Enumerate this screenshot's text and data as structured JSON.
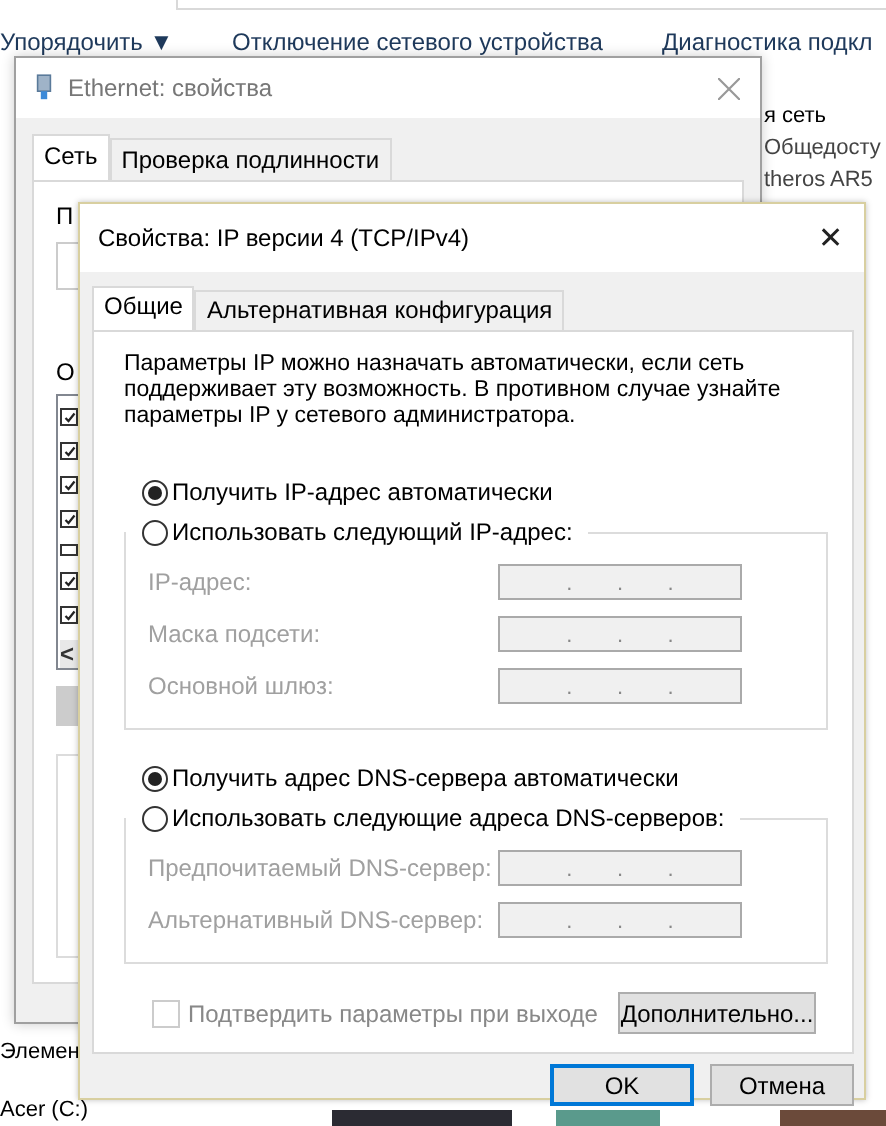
{
  "explorer": {
    "toolbar": [
      "Упорядочить ▼",
      "Отключение сетевого устройства",
      "Диагностика подкл"
    ],
    "details": [
      {
        "text": "я сеть",
        "bold": true
      },
      {
        "text": "Общедосту",
        "bold": false
      },
      {
        "text": "theros AR5",
        "bold": false
      }
    ],
    "labels": [
      "Элемен",
      "Acer (C:)"
    ]
  },
  "ethernet_window": {
    "title": "Ethernet: свойства",
    "tabs": [
      {
        "label": "Сеть",
        "selected": true
      },
      {
        "label": "Проверка подлинности",
        "selected": false
      }
    ],
    "section_labels": [
      "П",
      "О"
    ],
    "components": [
      {
        "checked": true
      },
      {
        "checked": true
      },
      {
        "checked": true
      },
      {
        "checked": true
      },
      {
        "checked": false
      },
      {
        "checked": true
      },
      {
        "checked": true
      }
    ],
    "scroll_arrow": "<"
  },
  "ipv4_dialog": {
    "title": "Свойства: IP версии 4 (TCP/IPv4)",
    "close": "✕",
    "tabs": [
      {
        "label": "Общие",
        "selected": true
      },
      {
        "label": "Альтернативная конфигурация",
        "selected": false
      }
    ],
    "description": "Параметры IP можно назначать автоматически, если сеть поддерживает эту возможность. В противном случае узнайте параметры IP у сетевого администратора.",
    "separator": ".",
    "sections": [
      {
        "auto_option": {
          "label": "Получить IP-адрес автоматически",
          "selected": true
        },
        "manual_option": {
          "label": "Использовать следующий IP-адрес:",
          "selected": false
        },
        "fields": [
          {
            "label": "IP-адрес:",
            "disabled": true
          },
          {
            "label": "Маска подсети:",
            "disabled": true
          },
          {
            "label": "Основной шлюз:",
            "disabled": true
          }
        ]
      },
      {
        "auto_option": {
          "label": "Получить адрес DNS-сервера автоматически",
          "selected": true
        },
        "manual_option": {
          "label": "Использовать следующие адреса DNS-серверов:",
          "selected": false
        },
        "fields": [
          {
            "label": "Предпочитаемый DNS-сервер:",
            "disabled": true
          },
          {
            "label": "Альтернативный DNS-сервер:",
            "disabled": true
          }
        ]
      }
    ],
    "validate": {
      "label": "Подтвердить параметры при выходе",
      "checked": false,
      "disabled": true
    },
    "advanced_button": "Дополнительно...",
    "buttons": [
      {
        "label": "OK",
        "default": true
      },
      {
        "label": "Отмена",
        "default": false
      }
    ]
  }
}
